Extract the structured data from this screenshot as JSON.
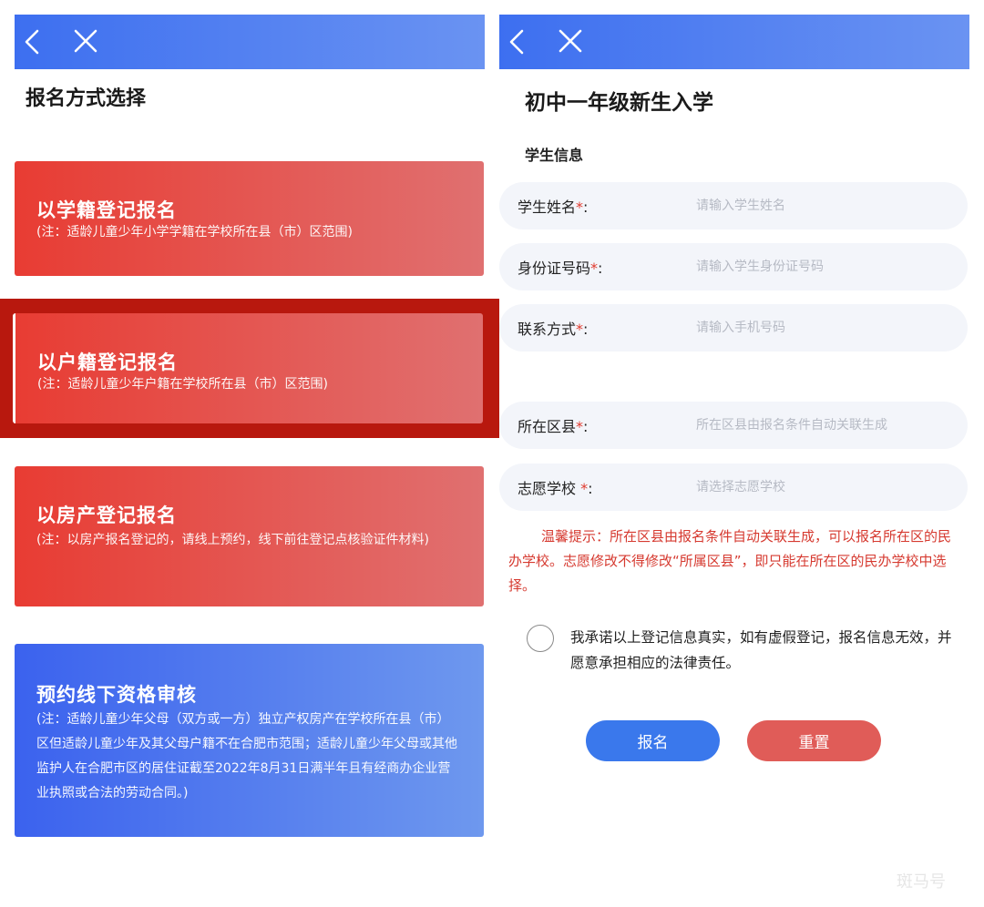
{
  "left": {
    "title": "报名方式选择",
    "cards": [
      {
        "title": "以学籍登记报名",
        "note": "(注：适龄儿童少年小学学籍在学校所在县（市）区范围)"
      },
      {
        "title": "以户籍登记报名",
        "note": "(注：适龄儿童少年户籍在学校所在县（市）区范围)"
      },
      {
        "title": "以房产登记报名",
        "note": "(注：以房产报名登记的，请线上预约，线下前往登记点核验证件材料)"
      },
      {
        "title": "预约线下资格审核",
        "note": "(注：适龄儿童少年父母（双方或一方）独立产权房产在学校所在县（市）区但适龄儿童少年及其父母户籍不在合肥市范围；适龄儿童少年父母或其他监护人在合肥市区的居住证截至2022年8月31日满半年且有经商办企业营业执照或合法的劳动合同。)"
      }
    ]
  },
  "right": {
    "title": "初中一年级新生入学",
    "section": "学生信息",
    "fields": [
      {
        "label": "学生姓名",
        "required": "*",
        "colon": ":",
        "placeholder": "请输入学生姓名"
      },
      {
        "label": "身份证号码",
        "required": "*",
        "colon": ":",
        "placeholder": "请输入学生身份证号码"
      },
      {
        "label": "联系方式",
        "required": "*",
        "colon": ":",
        "placeholder": "请输入手机号码"
      },
      {
        "label": "所在区县",
        "required": "*",
        "colon": ":",
        "placeholder": "所在区县由报名条件自动关联生成"
      },
      {
        "label": "志愿学校 ",
        "required": "*",
        "colon": ":",
        "placeholder": "请选择志愿学校"
      }
    ],
    "tip": "温馨提示：所在区县由报名条件自动关联生成，可以报名所在区的民办学校。志愿修改不得修改“所属区县”，即只能在所在区的民办学校中选择。",
    "agreement": "我承诺以上登记信息真实，如有虚假登记，报名信息无效，并愿意承担相应的法律责任。",
    "agreement_checked": false,
    "submit_label": "报名",
    "reset_label": "重置"
  },
  "watermark": "斑马号",
  "colors": {
    "nav_gradient_start": "#3d6ff0",
    "nav_gradient_end": "#6a93f2",
    "card_red": "#e83c33",
    "card_blue": "#3b62ee",
    "highlight_border": "#b8180e",
    "tip_text": "#d63a30",
    "submit_button": "#3a78ec",
    "reset_button": "#e05c58"
  },
  "icons": [
    "back-arrow-icon",
    "close-icon"
  ]
}
